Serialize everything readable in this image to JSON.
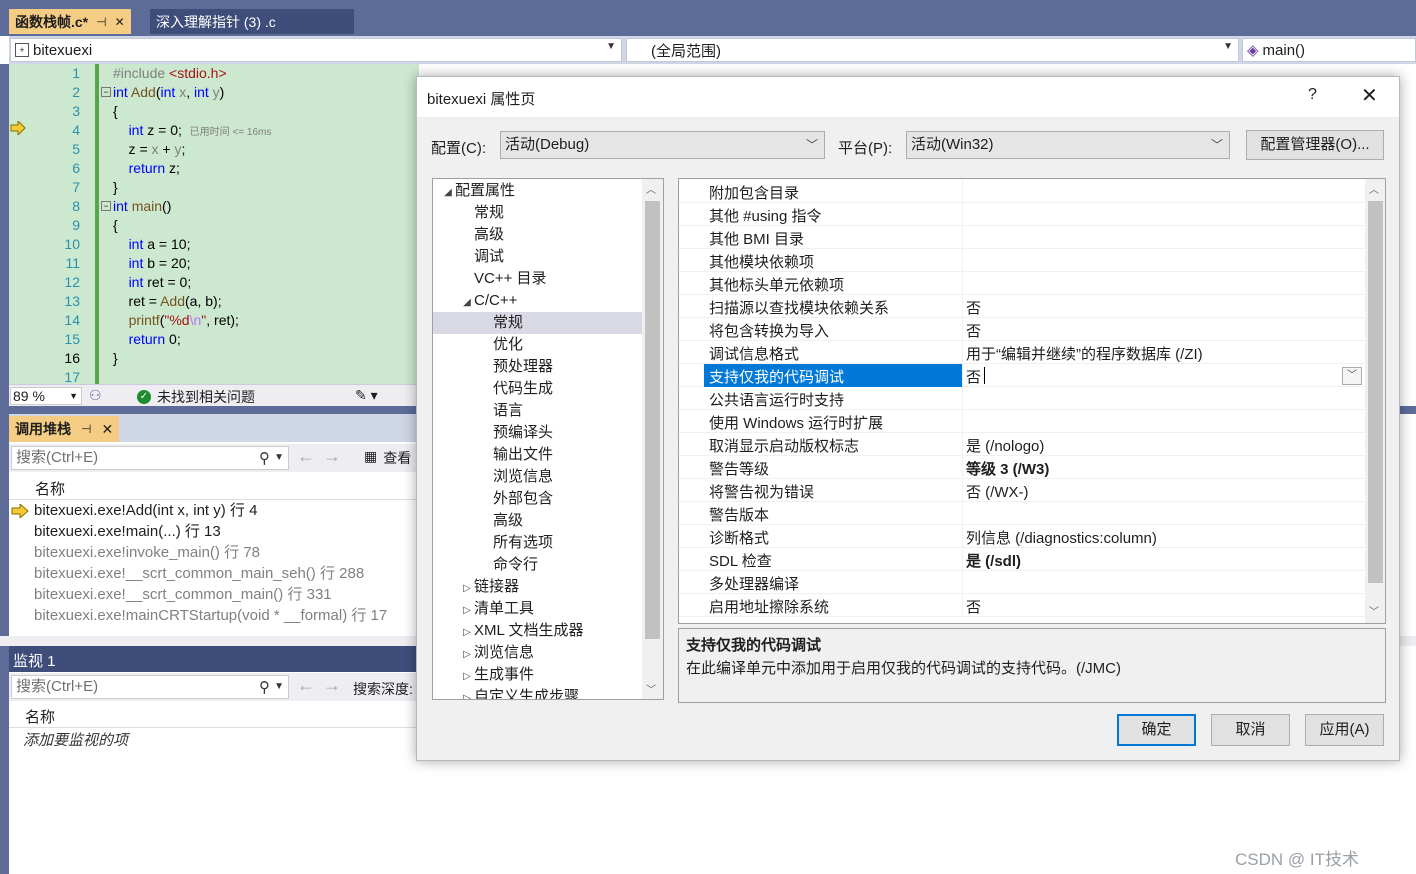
{
  "ide": {
    "tabs": [
      {
        "label": "函数栈帧.c*",
        "active": true
      },
      {
        "label": "深入理解指针 (3) .c",
        "active": false
      }
    ],
    "navbar": {
      "project": "bitexuexi",
      "scope": "(全局范围)",
      "member": "main()"
    },
    "editor": {
      "line_numbers": [
        "1",
        "2",
        "3",
        "4",
        "5",
        "6",
        "7",
        "8",
        "9",
        "10",
        "11",
        "12",
        "13",
        "14",
        "15",
        "16",
        "17"
      ],
      "elapsed_hint": "已用时间 <= 16ms",
      "code_lines": [
        "#include <stdio.h>",
        "int Add(int x, int y)",
        "{",
        "    int z = 0;",
        "    z = x + y;",
        "    return z;",
        "}",
        "int main()",
        "{",
        "    int a = 10;",
        "    int b = 20;",
        "    int ret = 0;",
        "    ret = Add(a, b);",
        "    printf(\"%d\\n\", ret);",
        "    return 0;",
        "}",
        ""
      ]
    },
    "status": {
      "zoom": "89 %",
      "message": "未找到相关问题"
    },
    "call_stack": {
      "title": "调用堆栈",
      "search_placeholder": "搜索(Ctrl+E)",
      "view_label": "查看",
      "column_name": "名称",
      "rows": [
        {
          "text": "bitexuexi.exe!Add(int x, int y) 行 4",
          "dim": false
        },
        {
          "text": "bitexuexi.exe!main(...) 行 13",
          "dim": false
        },
        {
          "text": "bitexuexi.exe!invoke_main() 行 78",
          "dim": true
        },
        {
          "text": "bitexuexi.exe!__scrt_common_main_seh() 行 288",
          "dim": true
        },
        {
          "text": "bitexuexi.exe!__scrt_common_main() 行 331",
          "dim": true
        },
        {
          "text": "bitexuexi.exe!mainCRTStartup(void * __formal) 行 17",
          "dim": true
        }
      ]
    },
    "watch": {
      "title": "监视 1",
      "search_placeholder": "搜索(Ctrl+E)",
      "depth_label": "搜索深度:",
      "column_name": "名称",
      "add_item": "添加要监视的项"
    }
  },
  "dialog": {
    "title": "bitexuexi 属性页",
    "help": "?",
    "close": "✕",
    "config_label": "配置(C):",
    "config_value": "活动(Debug)",
    "platform_label": "平台(P):",
    "platform_value": "活动(Win32)",
    "config_manager": "配置管理器(O)...",
    "tree": [
      {
        "label": "配置属性",
        "level": 0,
        "twisty": "◢"
      },
      {
        "label": "常规",
        "level": 1
      },
      {
        "label": "高级",
        "level": 1
      },
      {
        "label": "调试",
        "level": 1
      },
      {
        "label": "VC++ 目录",
        "level": 1
      },
      {
        "label": "C/C++",
        "level": 1,
        "twisty": "◢"
      },
      {
        "label": "常规",
        "level": 2,
        "selected": true
      },
      {
        "label": "优化",
        "level": 2
      },
      {
        "label": "预处理器",
        "level": 2
      },
      {
        "label": "代码生成",
        "level": 2
      },
      {
        "label": "语言",
        "level": 2
      },
      {
        "label": "预编译头",
        "level": 2
      },
      {
        "label": "输出文件",
        "level": 2
      },
      {
        "label": "浏览信息",
        "level": 2
      },
      {
        "label": "外部包含",
        "level": 2
      },
      {
        "label": "高级",
        "level": 2
      },
      {
        "label": "所有选项",
        "level": 2
      },
      {
        "label": "命令行",
        "level": 2
      },
      {
        "label": "链接器",
        "level": 1,
        "twisty": "▷"
      },
      {
        "label": "清单工具",
        "level": 1,
        "twisty": "▷"
      },
      {
        "label": "XML 文档生成器",
        "level": 1,
        "twisty": "▷"
      },
      {
        "label": "浏览信息",
        "level": 1,
        "twisty": "▷"
      },
      {
        "label": "生成事件",
        "level": 1,
        "twisty": "▷"
      },
      {
        "label": "自定义生成步骤",
        "level": 1,
        "twisty": "▷"
      }
    ],
    "properties": [
      {
        "name": "附加包含目录",
        "value": ""
      },
      {
        "name": "其他 #using 指令",
        "value": ""
      },
      {
        "name": "其他 BMI 目录",
        "value": ""
      },
      {
        "name": "其他模块依赖项",
        "value": ""
      },
      {
        "name": "其他标头单元依赖项",
        "value": ""
      },
      {
        "name": "扫描源以查找模块依赖关系",
        "value": "否"
      },
      {
        "name": "将包含转换为导入",
        "value": "否"
      },
      {
        "name": "调试信息格式",
        "value": "用于“编辑并继续”的程序数据库 (/ZI)"
      },
      {
        "name": "支持仅我的代码调试",
        "value": "否",
        "selected": true
      },
      {
        "name": "公共语言运行时支持",
        "value": ""
      },
      {
        "name": "使用 Windows 运行时扩展",
        "value": ""
      },
      {
        "name": "取消显示启动版权标志",
        "value": "是 (/nologo)"
      },
      {
        "name": "警告等级",
        "value": "等级 3 (/W3)",
        "bold": true
      },
      {
        "name": "将警告视为错误",
        "value": "否 (/WX-)"
      },
      {
        "name": "警告版本",
        "value": ""
      },
      {
        "name": "诊断格式",
        "value": "列信息 (/diagnostics:column)"
      },
      {
        "name": "SDL 检查",
        "value": "是 (/sdl)",
        "bold": true
      },
      {
        "name": "多处理器编译",
        "value": ""
      },
      {
        "name": "启用地址擦除系统",
        "value": "否"
      }
    ],
    "description": {
      "title": "支持仅我的代码调试",
      "text": "在此编译单元中添加用于启用仅我的代码调试的支持代码。(/JMC)"
    },
    "buttons": {
      "ok": "确定",
      "cancel": "取消",
      "apply": "应用(A)"
    }
  },
  "watermark": "CSDN @ IT技术"
}
